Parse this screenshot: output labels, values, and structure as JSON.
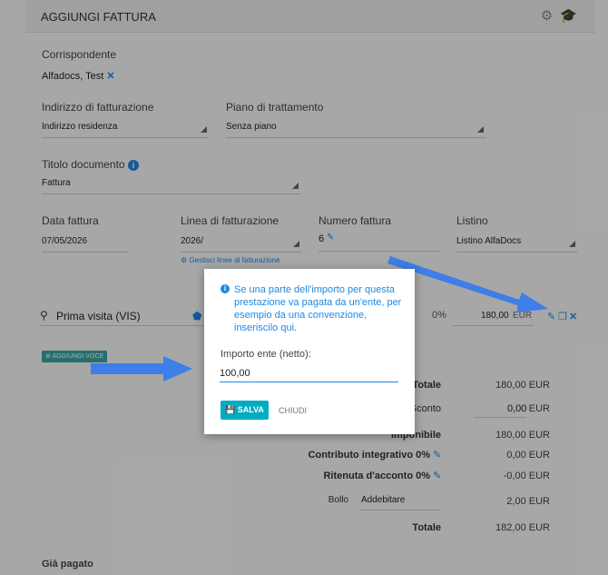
{
  "header": {
    "title": "AGGIUNGI FATTURA",
    "icons": "⚙ 🎓"
  },
  "form": {
    "corrispondente_label": "Corrispondente",
    "corrispondente_value": "Alfadocs, Test",
    "indirizzo_label": "Indirizzo di fatturazione",
    "indirizzo_value": "Indirizzo residenza",
    "piano_label": "Piano di trattamento",
    "piano_value": "Senza piano",
    "titolo_label": "Titolo documento",
    "titolo_value": "Fattura",
    "data_label": "Data fattura",
    "data_value": "07/05/2026",
    "linea_label": "Linea di fatturazione",
    "linea_value": "2026/",
    "linea_link": "Gestisci linee di fatturazione",
    "numero_label": "Numero fattura",
    "numero_value": "6",
    "listino_label": "Listino",
    "listino_value": "Listino AlfaDocs"
  },
  "voce": {
    "name": "Prima visita (VIS)",
    "percent": "0%",
    "amount": "180,00",
    "currency": "EUR",
    "add_label": "AGGIUNGI VOCE"
  },
  "totals": {
    "totale_label": "Totale",
    "totale_value": "180,00 EUR",
    "sconto_label": "Sconto",
    "sconto_value": "0,00",
    "sconto_currency": "EUR",
    "imponibile_label": "Imponibile",
    "imponibile_value": "180,00 EUR",
    "contributo_label": "Contributo integrativo 0%",
    "contributo_value": "0,00 EUR",
    "ritenuta_label": "Ritenuta d'acconto 0%",
    "ritenuta_value": "-0,00 EUR",
    "bollo_label": "Bollo",
    "bollo_select": "Addebitare",
    "bollo_value": "2,00 EUR",
    "totale2_label": "Totale",
    "totale2_value": "182,00 EUR"
  },
  "gia_pagato": "Già pagato",
  "modal": {
    "message": "Se una parte dell'importo per questa prestazione va pagata da un'ente, per esempio da una convenzione, inseriscilo qui.",
    "field_label": "Importo ente (netto):",
    "field_value": "100,00",
    "save_label": "SALVA",
    "close_label": "CHIUDI"
  },
  "colors": {
    "accent": "#1e88e5",
    "save": "#00acc1",
    "add": "#3aa6a6",
    "arrow": "#3d7ee8"
  }
}
